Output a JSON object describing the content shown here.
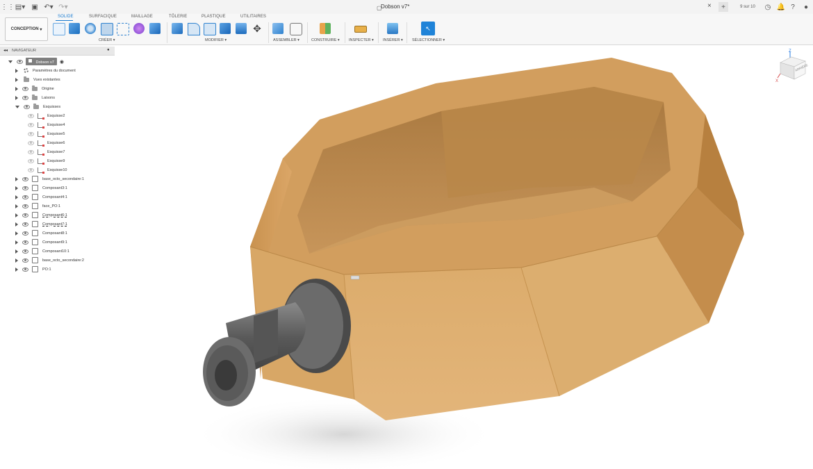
{
  "document": {
    "title": "Dobson v7*"
  },
  "titlebar": {
    "job_status": "9 sur 10"
  },
  "workspace": {
    "label": "CONCEPTION"
  },
  "tabs": [
    {
      "label": "SOLIDE",
      "active": true
    },
    {
      "label": "SURFACIQUE",
      "active": false
    },
    {
      "label": "MAILLAGE",
      "active": false
    },
    {
      "label": "TÔLERIE",
      "active": false
    },
    {
      "label": "PLASTIQUE",
      "active": false
    },
    {
      "label": "UTILITAIRES",
      "active": false
    }
  ],
  "tool_groups": {
    "create": "CRÉER ▾",
    "modify": "MODIFIER ▾",
    "assemble": "ASSEMBLER ▾",
    "construct": "CONSTRUIRE ▾",
    "inspect": "INSPECTER ▾",
    "insert": "INSÉRER ▾",
    "select": "SÉLECTIONNER ▾"
  },
  "browser": {
    "title": "NAVIGATEUR",
    "root": "Dobson v7",
    "items": [
      {
        "label": "Paramètres du document",
        "icon": "gear"
      },
      {
        "label": "Vues existantes",
        "icon": "folder"
      },
      {
        "label": "Origine",
        "icon": "folder"
      },
      {
        "label": "Laisons",
        "icon": "folder"
      },
      {
        "label": "Esquisses",
        "icon": "folder"
      }
    ],
    "sketches": [
      "Esquisse2",
      "Esquisse4",
      "Esquisse5",
      "Esquisse6",
      "Esquisse7",
      "Esquisse9",
      "Esquisse10"
    ],
    "components": [
      "base_octo_secondaire:1",
      "Composant3:1",
      "Composant4:1",
      "face_PO:1",
      "Composant6:1",
      "Composant7:1",
      "Composant8:1",
      "Composant9:1",
      "Composant10:1",
      "base_octo_secondaire:2",
      "PO:1"
    ]
  },
  "viewcube": {
    "face_label": "ARRIÈRE",
    "axis_x": "X",
    "axis_z": "Z"
  },
  "colors": {
    "accent": "#1a7bd0",
    "wood": "#d9a868",
    "metal": "#5b5b5b"
  }
}
